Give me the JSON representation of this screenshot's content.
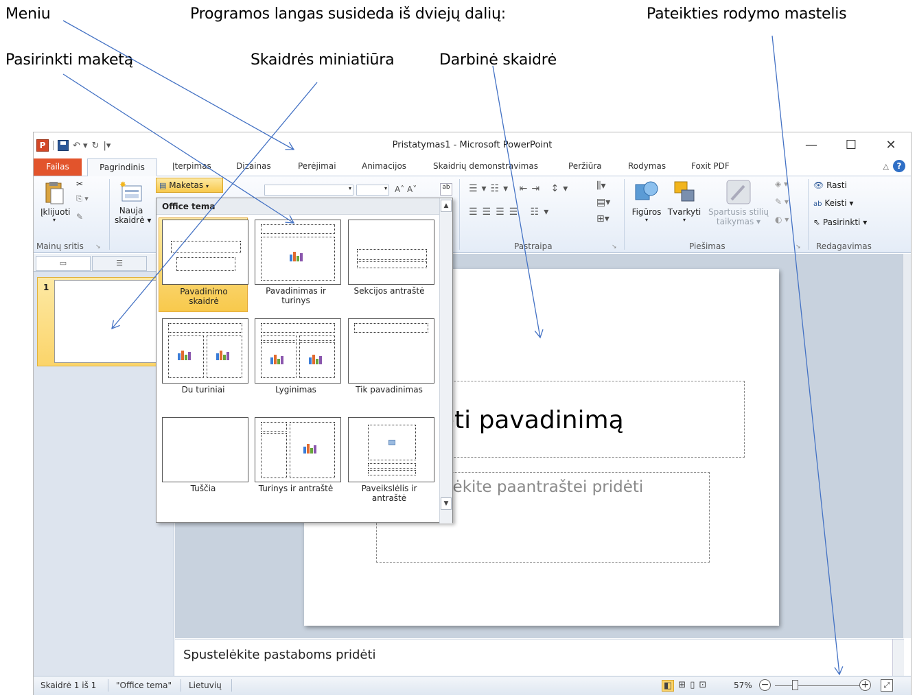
{
  "annotations": {
    "menu": "Meniu",
    "window_parts": "Programos langas susideda iš dviejų dalių:",
    "zoom": "Pateikties rodymo mastelis",
    "layout": "Pasirinkti maketą",
    "thumbnail": "Skaidrės miniatiūra",
    "working_slide": "Darbinė skaidrė"
  },
  "window": {
    "title": "Pristatymas1 - Microsoft PowerPoint"
  },
  "tabs": {
    "file": "Failas",
    "items": [
      "Pagrindinis",
      "Įterpimas",
      "Dizainas",
      "Perėjimai",
      "Animacijos",
      "Skaidrių demonstravimas",
      "Peržiūra",
      "Rodymas",
      "Foxit PDF"
    ]
  },
  "ribbon": {
    "paste": "Įklijuoti",
    "new_slide": "Nauja\nskaidrė",
    "layout_button": "Maketas",
    "clipboard_group": "Mainų sritis",
    "paragraph_group": "Pastraipa",
    "drawing_group": "Piešimas",
    "editing_group": "Redagavimas",
    "shapes": "Figūros",
    "arrange": "Tvarkyti",
    "quick_styles": "Spartusis stilių\ntaikymas",
    "find": "Rasti",
    "replace": "Keisti",
    "select": "Pasirinkti"
  },
  "layout_gallery": {
    "header": "Office tema",
    "items": [
      "Pavadinimo skaidrė",
      "Pavadinimas ir turinys",
      "Sekcijos antraštė",
      "Du turiniai",
      "Lyginimas",
      "Tik pavadinimas",
      "Tuščia",
      "Turinys ir antraštė",
      "Paveikslėlis ir antraštė"
    ]
  },
  "thumbnails": {
    "slide_number": "1"
  },
  "slide": {
    "title_placeholder": "idėti pavadinimą",
    "subtitle_placeholder": "elėkite paantraštei pridėti"
  },
  "notes": {
    "placeholder": "Spustelėkite pastaboms pridėti"
  },
  "status": {
    "slide": "Skaidrė 1 iš 1",
    "theme": "\"Office tema\"",
    "language": "Lietuvių",
    "zoom": "57%"
  }
}
